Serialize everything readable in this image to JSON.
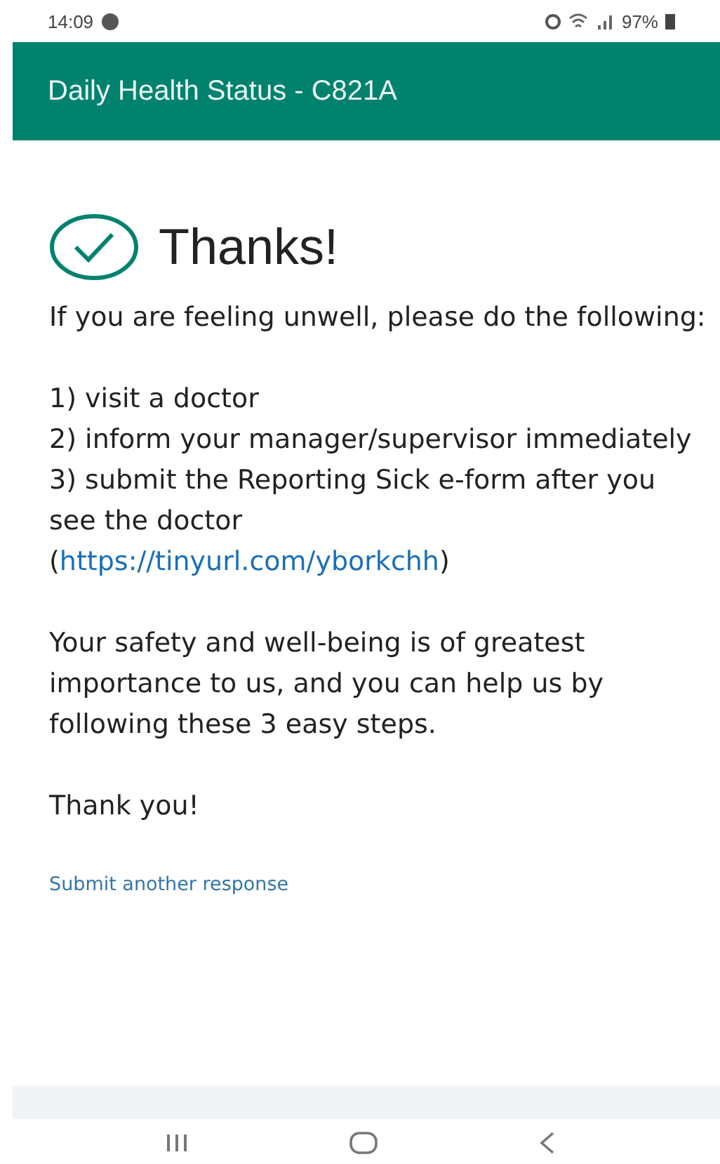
{
  "status_bar": {
    "time": "14:09",
    "battery": "97%"
  },
  "header": {
    "title": "Daily Health Status - C821A"
  },
  "confirmation": {
    "title": "Thanks!",
    "paragraphs": [
      {
        "lines": [
          {
            "text": "If you are feeling unwell, please do the following:"
          }
        ]
      },
      {
        "lines": [
          {
            "text": "1) visit a doctor"
          },
          {
            "text": "2) inform your manager/supervisor immediately"
          },
          {
            "text": "3) submit the Reporting Sick e-form after you see the doctor",
            "link_before": "(",
            "link": "https://tinyurl.com/yborkchh",
            "link_after": ")"
          }
        ]
      },
      {
        "lines": [
          {
            "text": "Your safety and well-being is of greatest importance to us, and you can help us by following these 3 easy steps."
          }
        ]
      },
      {
        "lines": [
          {
            "text": "Thank you!"
          }
        ]
      }
    ],
    "action_link": "Submit another response"
  }
}
